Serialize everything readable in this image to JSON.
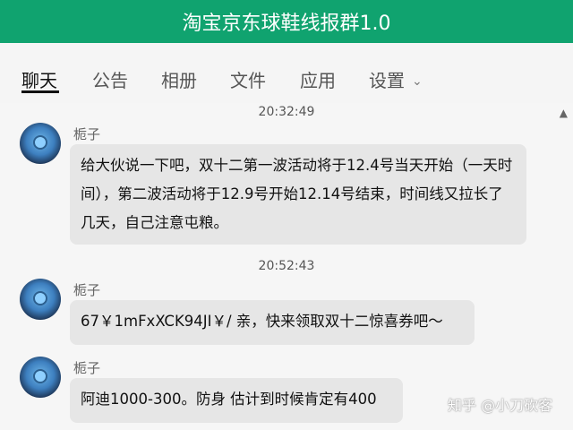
{
  "window": {
    "title": "淘宝京东球鞋线报群1.0"
  },
  "tabs": [
    {
      "label": "聊天",
      "active": true
    },
    {
      "label": "公告"
    },
    {
      "label": "相册"
    },
    {
      "label": "文件"
    },
    {
      "label": "应用"
    },
    {
      "label": "设置"
    }
  ],
  "chat": {
    "timestamps": [
      "20:32:49",
      "20:52:43"
    ],
    "messages": [
      {
        "sender": "栀子",
        "text": "给大伙说一下吧，双十二第一波活动将于12.4号当天开始（一天时间），第二波活动将于12.9号开始12.14号结束，时间线又拉长了几天，自己注意屯粮。"
      },
      {
        "sender": "栀子",
        "text": "67￥1mFxXCK94JI￥/ 亲，快来领取双十二惊喜券吧～"
      },
      {
        "sender": "栀子",
        "text": "阿迪1000-300。防身 估计到时候肯定有400"
      }
    ]
  },
  "watermark": "知乎 @小刀砍客",
  "colors": {
    "header": "#10a36f",
    "bubble": "#e6e6e6",
    "chat_bg": "#f6f6f6"
  },
  "icons": {
    "tab_dropdown": "chevron-down-icon",
    "scroll": "scroll-up-icon"
  }
}
